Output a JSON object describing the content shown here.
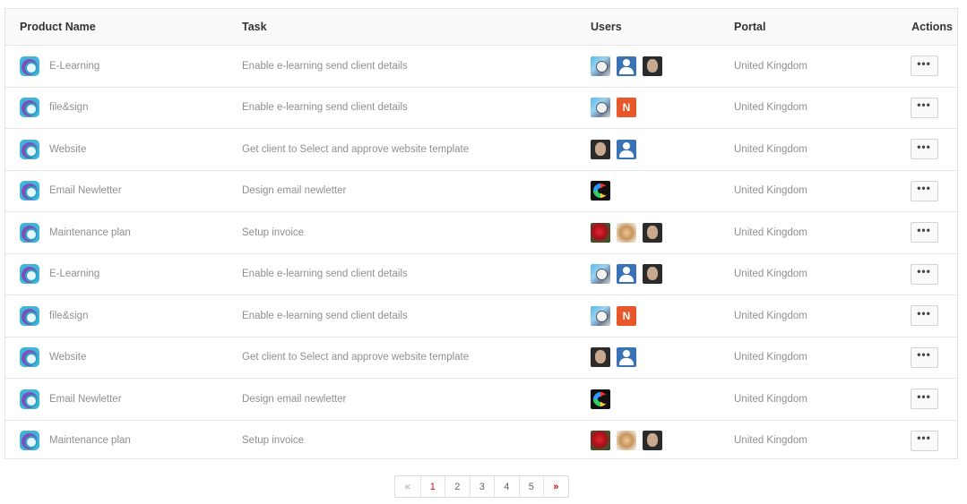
{
  "columns": {
    "product": "Product Name",
    "task": "Task",
    "users": "Users",
    "portal": "Portal",
    "actions": "Actions"
  },
  "rows": [
    {
      "product": "E-Learning",
      "task": "Enable e-learning send client details",
      "users": [
        "tom-avatar",
        "user-avatar",
        "face-avatar"
      ],
      "portal": "United Kingdom"
    },
    {
      "product": "file&sign",
      "task": "Enable e-learning send client details",
      "users": [
        "tom-avatar",
        "n-avatar"
      ],
      "portal": "United Kingdom"
    },
    {
      "product": "Website",
      "task": "Get client to Select and approve website template",
      "users": [
        "face-avatar",
        "user-avatar"
      ],
      "portal": "United Kingdom"
    },
    {
      "product": "Email Newletter",
      "task": "Design email newletter",
      "users": [
        "c-logo-avatar"
      ],
      "portal": "United Kingdom"
    },
    {
      "product": "Maintenance plan",
      "task": "Setup invoice",
      "users": [
        "rose-avatar",
        "lion-avatar",
        "face-avatar"
      ],
      "portal": "United Kingdom"
    },
    {
      "product": "E-Learning",
      "task": "Enable e-learning send client details",
      "users": [
        "tom-avatar",
        "user-avatar",
        "face-avatar"
      ],
      "portal": "United Kingdom"
    },
    {
      "product": "file&sign",
      "task": "Enable e-learning send client details",
      "users": [
        "tom-avatar",
        "n-avatar"
      ],
      "portal": "United Kingdom"
    },
    {
      "product": "Website",
      "task": "Get client to Select and approve website template",
      "users": [
        "face-avatar",
        "user-avatar"
      ],
      "portal": "United Kingdom"
    },
    {
      "product": "Email Newletter",
      "task": "Design email newletter",
      "users": [
        "c-logo-avatar"
      ],
      "portal": "United Kingdom"
    },
    {
      "product": "Maintenance plan",
      "task": "Setup invoice",
      "users": [
        "rose-avatar",
        "lion-avatar",
        "face-avatar"
      ],
      "portal": "United Kingdom"
    }
  ],
  "avatar_letter_n": "N",
  "action_label": "•••",
  "pagination": {
    "prev": "«",
    "pages": [
      "1",
      "2",
      "3",
      "4",
      "5"
    ],
    "next": "»",
    "active_page": "1"
  },
  "colors": {
    "accent": "#d0021b",
    "product_icon": "#3fb6d9",
    "n_avatar": "#e8572a"
  }
}
